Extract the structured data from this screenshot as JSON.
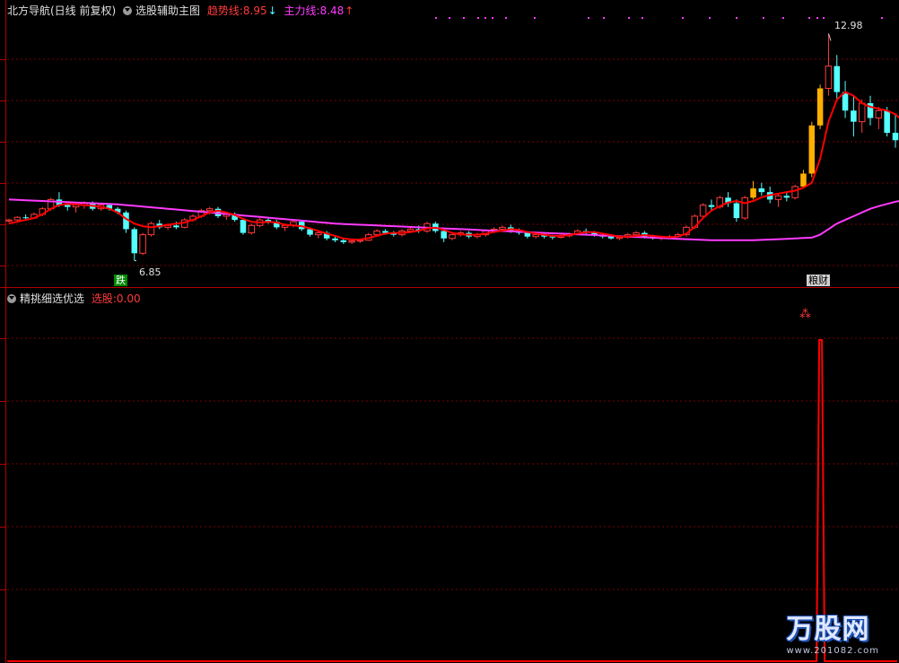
{
  "top_panel": {
    "indicator_name": "北方导航(日线 前复权)",
    "sub_name": "选股辅助主图",
    "trend_label": "趋势线:",
    "trend_value": "8.95",
    "trend_arrow": "↓",
    "main_label": "主力线:",
    "main_value": "8.48",
    "main_arrow": "↑",
    "high_label": "12.98",
    "low_label": "6.85",
    "signal_left": "跌",
    "signal_right": "粮财"
  },
  "bottom_panel": {
    "indicator_name": "精挑细选优选",
    "select_label": "选股:",
    "select_value": "0.00"
  },
  "watermark": {
    "brand": "万股网",
    "url": "www.201082.com"
  },
  "colors": {
    "up": "#ff3b3b",
    "down": "#54ffff",
    "trend": "#ff0000",
    "main": "#ff3bff",
    "yellow": "#ffb000",
    "grid": "#7a0000",
    "label_trend": "#ff3b3b",
    "label_main": "#ff3bff"
  },
  "chart_data": {
    "type": "candlestick",
    "y_range": [
      6.5,
      13.4
    ],
    "candles_ohlc": [
      [
        7.92,
        7.98,
        7.88,
        7.95
      ],
      [
        7.95,
        8.05,
        7.9,
        8.02
      ],
      [
        8.02,
        8.1,
        7.95,
        8.0
      ],
      [
        8.0,
        8.15,
        7.98,
        8.1
      ],
      [
        8.1,
        8.3,
        8.05,
        8.25
      ],
      [
        8.25,
        8.55,
        8.2,
        8.5
      ],
      [
        8.5,
        8.7,
        8.3,
        8.35
      ],
      [
        8.35,
        8.45,
        8.2,
        8.3
      ],
      [
        8.3,
        8.4,
        8.15,
        8.35
      ],
      [
        8.35,
        8.45,
        8.25,
        8.4
      ],
      [
        8.4,
        8.45,
        8.2,
        8.25
      ],
      [
        8.25,
        8.4,
        8.2,
        8.35
      ],
      [
        8.35,
        8.4,
        8.2,
        8.25
      ],
      [
        8.25,
        8.3,
        8.1,
        8.15
      ],
      [
        8.15,
        8.2,
        7.6,
        7.7
      ],
      [
        7.7,
        7.75,
        6.85,
        7.05
      ],
      [
        7.05,
        7.6,
        7.0,
        7.55
      ],
      [
        7.55,
        7.9,
        7.5,
        7.85
      ],
      [
        7.85,
        7.95,
        7.7,
        7.75
      ],
      [
        7.75,
        7.85,
        7.68,
        7.8
      ],
      [
        7.8,
        7.9,
        7.7,
        7.75
      ],
      [
        7.75,
        8.0,
        7.72,
        7.95
      ],
      [
        7.95,
        8.1,
        7.9,
        8.05
      ],
      [
        8.05,
        8.25,
        8.0,
        8.2
      ],
      [
        8.2,
        8.3,
        8.1,
        8.25
      ],
      [
        8.25,
        8.3,
        8.0,
        8.05
      ],
      [
        8.05,
        8.15,
        7.95,
        8.1
      ],
      [
        8.1,
        8.15,
        7.9,
        7.95
      ],
      [
        7.95,
        8.0,
        7.55,
        7.6
      ],
      [
        7.6,
        7.85,
        7.55,
        7.8
      ],
      [
        7.8,
        8.0,
        7.75,
        7.95
      ],
      [
        7.95,
        8.0,
        7.85,
        7.9
      ],
      [
        7.9,
        7.95,
        7.7,
        7.75
      ],
      [
        7.75,
        7.85,
        7.65,
        7.8
      ],
      [
        7.8,
        7.95,
        7.75,
        7.9
      ],
      [
        7.9,
        7.95,
        7.65,
        7.7
      ],
      [
        7.7,
        7.75,
        7.5,
        7.55
      ],
      [
        7.55,
        7.65,
        7.45,
        7.6
      ],
      [
        7.6,
        7.65,
        7.4,
        7.45
      ],
      [
        7.45,
        7.5,
        7.35,
        7.4
      ],
      [
        7.4,
        7.45,
        7.3,
        7.35
      ],
      [
        7.35,
        7.42,
        7.3,
        7.38
      ],
      [
        7.38,
        7.45,
        7.33,
        7.4
      ],
      [
        7.4,
        7.6,
        7.38,
        7.55
      ],
      [
        7.55,
        7.7,
        7.5,
        7.65
      ],
      [
        7.65,
        7.7,
        7.55,
        7.6
      ],
      [
        7.6,
        7.65,
        7.5,
        7.55
      ],
      [
        7.55,
        7.7,
        7.5,
        7.65
      ],
      [
        7.65,
        7.75,
        7.6,
        7.7
      ],
      [
        7.7,
        7.8,
        7.6,
        7.65
      ],
      [
        7.65,
        7.9,
        7.6,
        7.85
      ],
      [
        7.85,
        7.9,
        7.6,
        7.65
      ],
      [
        7.65,
        7.7,
        7.35,
        7.45
      ],
      [
        7.45,
        7.6,
        7.4,
        7.55
      ],
      [
        7.55,
        7.65,
        7.5,
        7.6
      ],
      [
        7.6,
        7.65,
        7.45,
        7.5
      ],
      [
        7.5,
        7.6,
        7.45,
        7.55
      ],
      [
        7.55,
        7.7,
        7.5,
        7.65
      ],
      [
        7.65,
        7.75,
        7.6,
        7.7
      ],
      [
        7.7,
        7.8,
        7.65,
        7.75
      ],
      [
        7.75,
        7.82,
        7.6,
        7.65
      ],
      [
        7.65,
        7.72,
        7.55,
        7.6
      ],
      [
        7.6,
        7.65,
        7.45,
        7.5
      ],
      [
        7.5,
        7.6,
        7.45,
        7.55
      ],
      [
        7.55,
        7.6,
        7.45,
        7.5
      ],
      [
        7.5,
        7.55,
        7.42,
        7.48
      ],
      [
        7.48,
        7.55,
        7.45,
        7.52
      ],
      [
        7.52,
        7.6,
        7.48,
        7.58
      ],
      [
        7.58,
        7.7,
        7.55,
        7.65
      ],
      [
        7.65,
        7.72,
        7.55,
        7.6
      ],
      [
        7.6,
        7.65,
        7.5,
        7.55
      ],
      [
        7.55,
        7.6,
        7.45,
        7.5
      ],
      [
        7.5,
        7.55,
        7.42,
        7.45
      ],
      [
        7.45,
        7.52,
        7.4,
        7.48
      ],
      [
        7.48,
        7.6,
        7.45,
        7.55
      ],
      [
        7.55,
        7.65,
        7.5,
        7.6
      ],
      [
        7.6,
        7.65,
        7.45,
        7.5
      ],
      [
        7.5,
        7.55,
        7.42,
        7.45
      ],
      [
        7.45,
        7.5,
        7.4,
        7.48
      ],
      [
        7.48,
        7.55,
        7.45,
        7.5
      ],
      [
        7.5,
        7.6,
        7.48,
        7.55
      ],
      [
        7.55,
        7.8,
        7.5,
        7.75
      ],
      [
        7.75,
        8.1,
        7.7,
        8.05
      ],
      [
        8.05,
        8.4,
        8.0,
        8.35
      ],
      [
        8.35,
        8.5,
        8.2,
        8.3
      ],
      [
        8.3,
        8.6,
        8.25,
        8.55
      ],
      [
        8.55,
        8.7,
        8.3,
        8.4
      ],
      [
        8.4,
        8.5,
        7.9,
        8.0
      ],
      [
        8.0,
        8.6,
        7.95,
        8.55
      ],
      [
        8.55,
        9.0,
        8.5,
        8.8
      ],
      [
        8.8,
        8.95,
        8.6,
        8.7
      ],
      [
        8.7,
        8.85,
        8.4,
        8.5
      ],
      [
        8.5,
        8.65,
        8.3,
        8.6
      ],
      [
        8.6,
        8.7,
        8.45,
        8.55
      ],
      [
        8.55,
        8.9,
        8.5,
        8.85
      ],
      [
        8.85,
        9.3,
        8.8,
        9.2
      ],
      [
        9.2,
        10.6,
        9.1,
        10.5
      ],
      [
        10.5,
        11.6,
        10.4,
        11.5
      ],
      [
        11.5,
        12.98,
        11.3,
        12.1
      ],
      [
        12.1,
        12.4,
        11.2,
        11.4
      ],
      [
        11.4,
        11.7,
        10.7,
        10.9
      ],
      [
        10.9,
        11.3,
        10.2,
        10.6
      ],
      [
        10.6,
        11.2,
        10.3,
        11.1
      ],
      [
        11.1,
        11.3,
        10.5,
        10.7
      ],
      [
        10.7,
        11.0,
        10.4,
        10.9
      ],
      [
        10.9,
        11.0,
        10.2,
        10.3
      ],
      [
        10.3,
        10.8,
        9.9,
        10.1
      ]
    ],
    "trend_line": [
      7.85,
      7.9,
      7.95,
      8.0,
      8.1,
      8.25,
      8.35,
      8.38,
      8.37,
      8.35,
      8.33,
      8.3,
      8.25,
      8.15,
      7.98,
      7.85,
      7.78,
      7.75,
      7.78,
      7.82,
      7.85,
      7.88,
      7.95,
      8.05,
      8.15,
      8.2,
      8.15,
      8.08,
      7.98,
      7.9,
      7.88,
      7.9,
      7.88,
      7.82,
      7.8,
      7.78,
      7.72,
      7.65,
      7.58,
      7.52,
      7.45,
      7.42,
      7.42,
      7.46,
      7.52,
      7.58,
      7.6,
      7.6,
      7.62,
      7.66,
      7.72,
      7.74,
      7.68,
      7.6,
      7.56,
      7.55,
      7.55,
      7.58,
      7.62,
      7.66,
      7.7,
      7.68,
      7.62,
      7.58,
      7.55,
      7.52,
      7.52,
      7.54,
      7.58,
      7.62,
      7.62,
      7.58,
      7.54,
      7.5,
      7.5,
      7.52,
      7.54,
      7.52,
      7.5,
      7.48,
      7.5,
      7.58,
      7.76,
      8.0,
      8.2,
      8.32,
      8.42,
      8.46,
      8.4,
      8.46,
      8.56,
      8.62,
      8.66,
      8.7,
      8.74,
      8.82,
      8.95,
      9.6,
      10.6,
      11.2,
      11.4,
      11.3,
      11.1,
      11.0,
      10.95,
      10.9,
      10.8,
      10.6
    ],
    "main_line": [
      8.5,
      8.49,
      8.48,
      8.47,
      8.46,
      8.45,
      8.44,
      8.43,
      8.42,
      8.41,
      8.4,
      8.39,
      8.38,
      8.37,
      8.35,
      8.33,
      8.31,
      8.29,
      8.27,
      8.25,
      8.23,
      8.21,
      8.19,
      8.17,
      8.15,
      8.13,
      8.11,
      8.09,
      8.07,
      8.05,
      8.03,
      8.01,
      7.99,
      7.97,
      7.95,
      7.93,
      7.91,
      7.89,
      7.87,
      7.85,
      7.84,
      7.83,
      7.82,
      7.81,
      7.8,
      7.79,
      7.78,
      7.77,
      7.76,
      7.75,
      7.74,
      7.73,
      7.72,
      7.71,
      7.7,
      7.69,
      7.68,
      7.67,
      7.66,
      7.65,
      7.64,
      7.63,
      7.62,
      7.61,
      7.6,
      7.59,
      7.58,
      7.57,
      7.56,
      7.55,
      7.54,
      7.53,
      7.52,
      7.51,
      7.5,
      7.49,
      7.48,
      7.47,
      7.46,
      7.45,
      7.44,
      7.43,
      7.42,
      7.41,
      7.4,
      7.4,
      7.4,
      7.4,
      7.4,
      7.4,
      7.41,
      7.42,
      7.43,
      7.44,
      7.45,
      7.46,
      7.47,
      7.55,
      7.7,
      7.85,
      7.95,
      8.05,
      8.15,
      8.25,
      8.32,
      8.38,
      8.44,
      8.48
    ],
    "yellow_bars_index": [
      89,
      95,
      96,
      97
    ],
    "select_signal": {
      "index": 97,
      "value": 1
    }
  }
}
